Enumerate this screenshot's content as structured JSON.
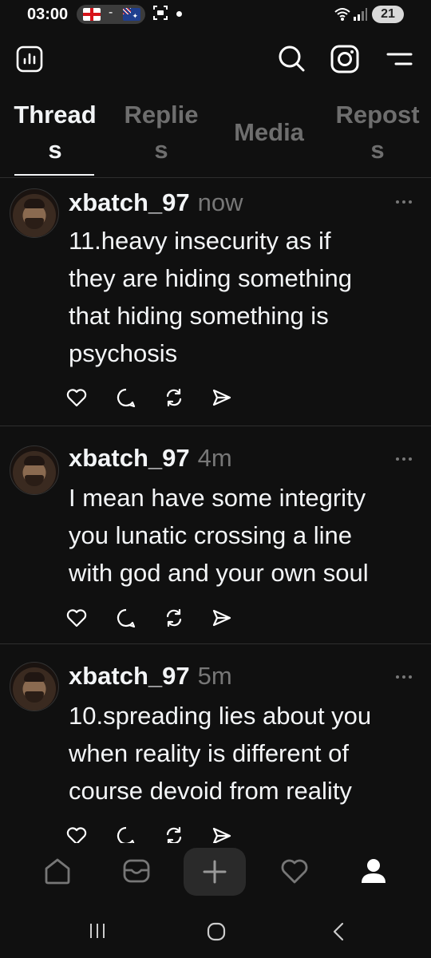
{
  "status_bar": {
    "time": "03:00",
    "battery": "21"
  },
  "header": {
    "icons": [
      "insights-icon",
      "search-icon",
      "instagram-icon",
      "menu-icon"
    ]
  },
  "tabs": [
    {
      "line1": "Thread",
      "line2": "s",
      "active": true
    },
    {
      "line1": "Replie",
      "line2": "s",
      "active": false
    },
    {
      "line1": "Media",
      "line2": "",
      "active": false
    },
    {
      "line1": "Repost",
      "line2": "s",
      "active": false
    }
  ],
  "posts": [
    {
      "username": "xbatch_97",
      "time": "now",
      "lines": [
        "11.heavy insecurity as if",
        "they are hiding something",
        "that hiding something is",
        "psychosis"
      ]
    },
    {
      "username": "xbatch_97",
      "time": "4m",
      "lines": [
        "I mean have some integrity",
        "you lunatic crossing a line",
        "with god and your own soul"
      ]
    },
    {
      "username": "xbatch_97",
      "time": "5m",
      "lines": [
        "10.spreading lies about you",
        "when reality is different of",
        "course devoid from reality"
      ]
    }
  ],
  "bottom_nav": {
    "items": [
      "home-icon",
      "inbox-icon",
      "compose-icon",
      "activity-icon",
      "profile-icon"
    ],
    "active": "profile-icon"
  },
  "colors": {
    "background": "#101010",
    "text": "#f3f5f7",
    "muted": "#6e6e6e",
    "divider": "#2e2e2e"
  }
}
